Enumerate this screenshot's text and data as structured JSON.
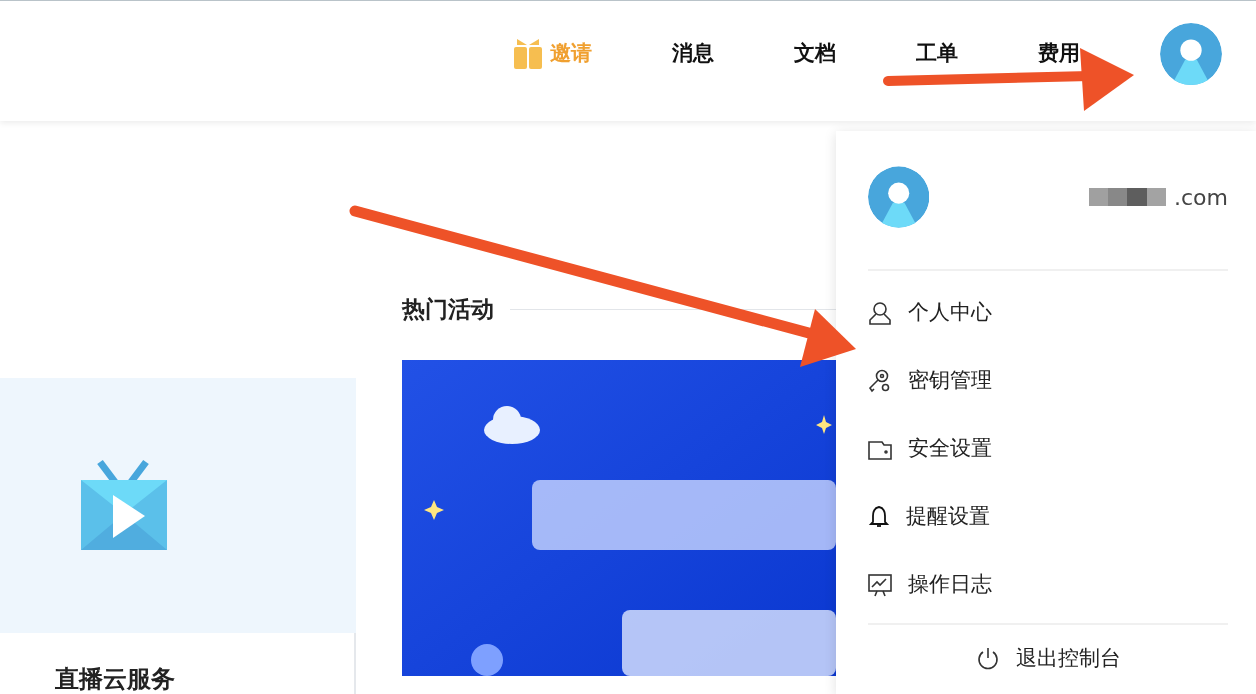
{
  "nav": {
    "items": [
      {
        "label": "邀请",
        "kind": "invite"
      },
      {
        "label": "消息",
        "kind": "plain"
      },
      {
        "label": "文档",
        "kind": "plain"
      },
      {
        "label": "工单",
        "kind": "plain"
      },
      {
        "label": "费用",
        "kind": "plain"
      }
    ]
  },
  "user_menu": {
    "email": ".com",
    "items": [
      {
        "label": "个人中心",
        "kind": "person"
      },
      {
        "label": "密钥管理",
        "kind": "key"
      },
      {
        "label": "安全设置",
        "kind": "wallet"
      },
      {
        "label": "提醒设置",
        "kind": "bell"
      },
      {
        "label": "操作日志",
        "kind": "chart"
      }
    ],
    "logout": "退出控制台"
  },
  "section_title": "热门活动",
  "service_card": {
    "title": "直播云服务"
  }
}
